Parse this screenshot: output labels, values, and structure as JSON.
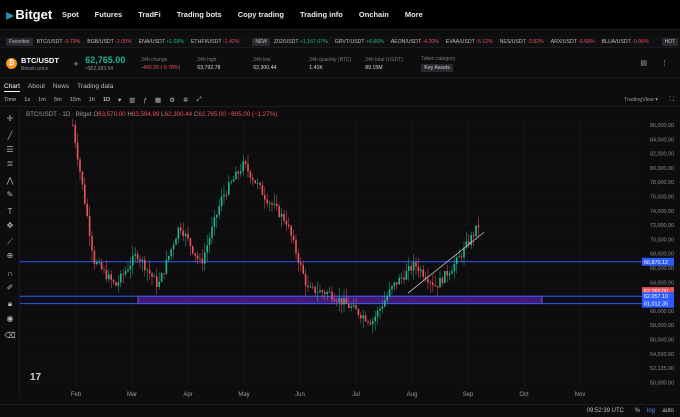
{
  "brand": {
    "name": "Bitget",
    "logo_icon": "bitget-logo-icon"
  },
  "nav": [
    "Spot",
    "Futures",
    "TradFi",
    "Trading bots",
    "Copy trading",
    "Trading info",
    "Onchain",
    "More"
  ],
  "ticker": {
    "favorites_label": "Favorites",
    "new_label": "NEW",
    "hot_label": "HOT",
    "favorites": [
      {
        "pair": "BTC/USDT",
        "change": "-0.79%",
        "dir": "down"
      },
      {
        "pair": "BGB/USDT",
        "change": "-2.00%",
        "dir": "down"
      },
      {
        "pair": "ENA/USDT",
        "change": "+1.03%",
        "dir": "up"
      },
      {
        "pair": "ETHFI/USDT",
        "change": "-1.42%",
        "dir": "down"
      }
    ],
    "new": [
      {
        "pair": "Z02/USDT",
        "change": "+1,167.67%",
        "dir": "up"
      },
      {
        "pair": "GRVT/USDT",
        "change": "+6.66%",
        "dir": "up"
      },
      {
        "pair": "AEON/USDT",
        "change": "-4.20%",
        "dir": "down"
      },
      {
        "pair": "EVAA/USDT",
        "change": "-5.12%",
        "dir": "down"
      },
      {
        "pair": "NES/USDT",
        "change": "-3.82%",
        "dir": "down"
      },
      {
        "pair": "ARX/USDT",
        "change": "-6.68%",
        "dir": "down"
      },
      {
        "pair": "BLUA/USDT",
        "change": "-0.06%",
        "dir": "down"
      }
    ],
    "hot": [
      {
        "pair": "Z02/USDT",
        "change": "+1,167.67%",
        "dir": "up"
      }
    ]
  },
  "instrument": {
    "pair": "BTC/USDT",
    "subtitle": "Bitcoin price",
    "price": "62,765.00",
    "price_sub": "≈$62,683.54",
    "stats": [
      {
        "label": "24h change",
        "value": "-490.26 (-0.78%)",
        "neg": true
      },
      {
        "label": "24h high",
        "value": "63,792.78",
        "neg": false
      },
      {
        "label": "24h low",
        "value": "62,300.44",
        "neg": false
      },
      {
        "label": "24h quantity (BTC)",
        "value": "1.41K",
        "neg": false
      },
      {
        "label": "24h total (USDT)",
        "value": "89.15M",
        "neg": false
      }
    ],
    "token_category_label": "Token category",
    "token_category_value": "Key Assets"
  },
  "tabs": [
    "Chart",
    "About",
    "News",
    "Trading data"
  ],
  "timeframes": [
    "Time",
    "1s",
    "1m",
    "5m",
    "15m",
    "1h",
    "1D"
  ],
  "tradingview_label": "TradingView ▾",
  "legend": {
    "pair": "BTC/USDT",
    "interval": "1D",
    "exchange": "Bitget",
    "o_label": "O",
    "o": "63,570.00",
    "h_label": "H",
    "h": "63,594.99",
    "l_label": "L",
    "l": "62,300.44",
    "c_label": "C",
    "c": "62,765.00",
    "chg": "−805.00 (−1.27%)"
  },
  "chart_data": {
    "type": "candlestick",
    "x_ticks": [
      "Feb",
      "Mar",
      "Apr",
      "May",
      "Jun",
      "Jul",
      "Aug",
      "Sep",
      "Oct",
      "Nov"
    ],
    "y_ticks": [
      86000,
      84000,
      82000,
      80000,
      78000,
      76000,
      74000,
      72000,
      70000,
      68000,
      66000,
      64000,
      62000,
      60000,
      58000,
      56000,
      54000,
      52000,
      50000
    ],
    "y_tick_labels": [
      "86,000.00",
      "84,000.00",
      "82,000.00",
      "80,000.00",
      "78,000.00",
      "76,000.00",
      "74,000.00",
      "72,000.00",
      "70,000.00",
      "68,000.00",
      "66,000.00",
      "64,000.00",
      "62,000.00",
      "60,000.00",
      "58,000.00",
      "56,000.00",
      "54,500.00",
      "52,135.00",
      "50,000.00"
    ],
    "ylim": [
      49500,
      86700
    ],
    "price_labels": [
      {
        "value": 66870.12,
        "text": "66,870.12",
        "color": "#2d5bff"
      },
      {
        "value": 62765.0,
        "text": "62,765.00",
        "color": "#e8545a"
      },
      {
        "value": 62057.1,
        "text": "62,057.10",
        "color": "#2d5bff"
      },
      {
        "value": 61012.35,
        "text": "61,012.35",
        "color": "#2d5bff"
      }
    ],
    "horizontal_lines": [
      66870.12,
      62057.1,
      61012.35
    ],
    "range_box": {
      "from_month": "Mar",
      "to_month": "Oct",
      "top": 62057.1,
      "bottom": 61012.35,
      "color": "#8a2be2"
    },
    "path": [
      [
        "Jan",
        86000
      ],
      [
        "Feb",
        67000
      ],
      [
        "Feb",
        63500
      ],
      [
        "Mar",
        68000
      ],
      [
        "Mar",
        63500
      ],
      [
        "Apr",
        72000
      ],
      [
        "Apr",
        66500
      ],
      [
        "May",
        76000
      ],
      [
        "May",
        80500
      ],
      [
        "May",
        76000
      ],
      [
        "Jun",
        72500
      ],
      [
        "Jun",
        63000
      ],
      [
        "Jun",
        62500
      ],
      [
        "Jul",
        60500
      ],
      [
        "Jul",
        58500
      ],
      [
        "Jul",
        63500
      ],
      [
        "Aug",
        66500
      ],
      [
        "Aug",
        63500
      ],
      [
        "Aug",
        67000
      ],
      [
        "Sep",
        72000
      ]
    ]
  },
  "bottom_bar": {
    "clock": "09:52:39 UTC",
    "pct": "%",
    "log": "log",
    "auto": "auto"
  },
  "colors": {
    "up": "#1fb88a",
    "down": "#e8545a",
    "blue_line": "#2d5bff",
    "range": "#8a2be2"
  }
}
